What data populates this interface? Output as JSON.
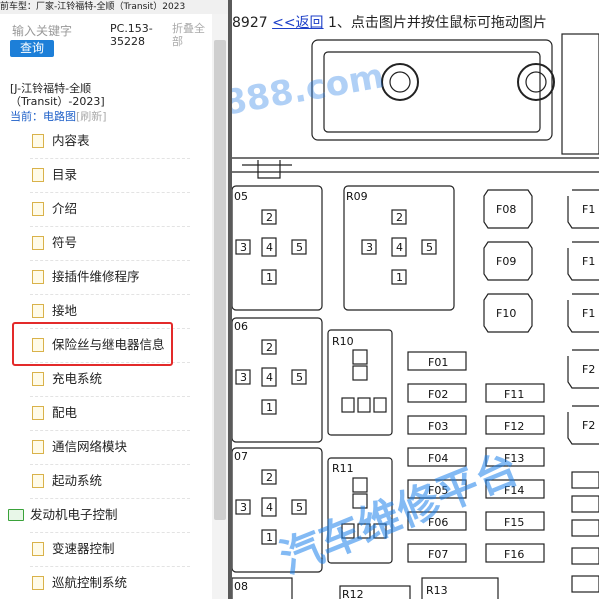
{
  "topbar": {
    "text": "前车型：厂家-江铃福特-全顺（Transit）2023"
  },
  "search": {
    "placeholder": "输入关键字",
    "query_label": "查询"
  },
  "pc": {
    "line1": "PC.153-",
    "line2": "35228"
  },
  "fold": {
    "line1": "折叠全",
    "line2": "部"
  },
  "crumb": {
    "line1": "[J-江铃福特-全顺",
    "line2": "（Transit）-2023]"
  },
  "current": {
    "label": "当前：电路图",
    "refresh": "[刷新]"
  },
  "tree": {
    "items": [
      {
        "label": "内容表",
        "kind": "doc"
      },
      {
        "label": "目录",
        "kind": "doc"
      },
      {
        "label": "介绍",
        "kind": "doc"
      },
      {
        "label": "符号",
        "kind": "doc"
      },
      {
        "label": "接插件维修程序",
        "kind": "doc"
      },
      {
        "label": "接地",
        "kind": "doc"
      },
      {
        "label": "保险丝与继电器信息",
        "kind": "doc"
      },
      {
        "label": "充电系统",
        "kind": "doc"
      },
      {
        "label": "配电",
        "kind": "doc"
      },
      {
        "label": "通信网络模块",
        "kind": "doc"
      },
      {
        "label": "起动系统",
        "kind": "doc"
      },
      {
        "label": "发动机电子控制",
        "kind": "folder"
      },
      {
        "label": "变速器控制",
        "kind": "doc"
      },
      {
        "label": "巡航控制系统",
        "kind": "doc"
      }
    ]
  },
  "viewer": {
    "code": "8927",
    "back": "<<返回",
    "instruction": "1、点击图片并按住鼠标可拖动图片",
    "watermark_top": "888.com",
    "watermark_bottom": "汽车维修平台"
  },
  "diagram": {
    "relays": [
      "05",
      "R09",
      "06",
      "R10",
      "07",
      "R11",
      "08",
      "R12",
      "R13"
    ],
    "fuses_left": [
      "F01",
      "F02",
      "F03",
      "F04",
      "F05",
      "F06",
      "F07"
    ],
    "fuses_mid": [
      "F11",
      "F12",
      "F13",
      "F14",
      "F15",
      "F16"
    ],
    "fuses_grid": [
      "F08",
      "F09",
      "F10"
    ],
    "fuses_edge": [
      "F1",
      "F1",
      "F1",
      "F2",
      "F2"
    ],
    "pins": [
      "1",
      "2",
      "3",
      "4",
      "5"
    ]
  }
}
